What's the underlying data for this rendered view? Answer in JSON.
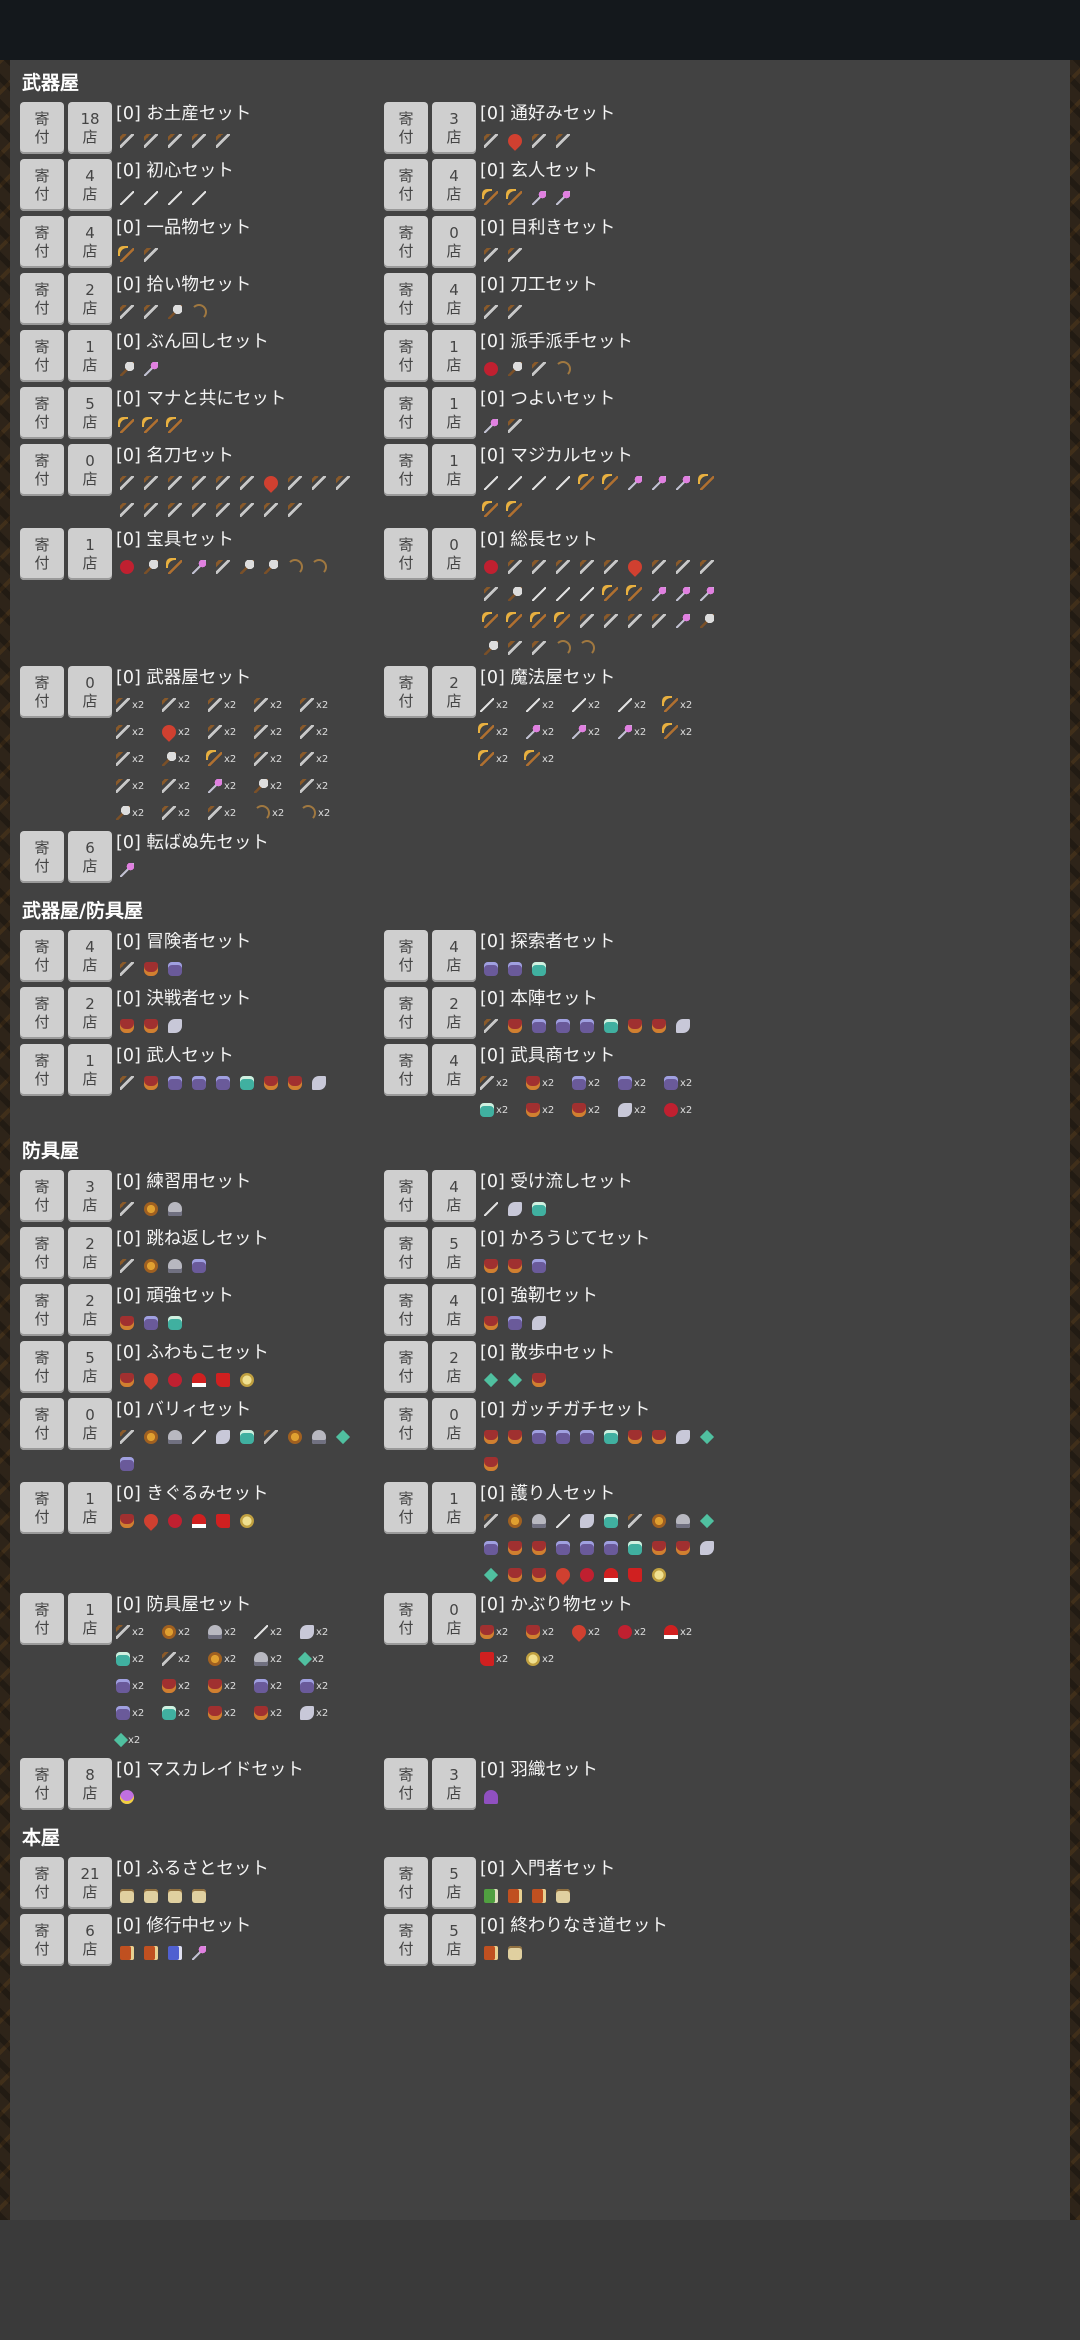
{
  "btn": {
    "donate": [
      "寄",
      "付"
    ],
    "shop_suffix": "店"
  },
  "sections": [
    {
      "title": "武器屋",
      "items": [
        {
          "shops": "18",
          "name": "[0] お土産セット",
          "icons": [
            "sword",
            "sword",
            "sword",
            "sword",
            "sword"
          ],
          "x2": false
        },
        {
          "shops": "3",
          "name": "[0] 通好みセット",
          "icons": [
            "sword",
            "fire",
            "sword",
            "sword"
          ],
          "x2": false
        },
        {
          "shops": "4",
          "name": "[0] 初心セット",
          "icons": [
            "spear",
            "spear",
            "spear",
            "spear"
          ],
          "x2": false
        },
        {
          "shops": "4",
          "name": "[0] 玄人セット",
          "icons": [
            "staff",
            "staff",
            "wand",
            "wand"
          ],
          "x2": false
        },
        {
          "shops": "4",
          "name": "[0] 一品物セット",
          "icons": [
            "staff",
            "sword"
          ],
          "x2": false
        },
        {
          "shops": "0",
          "name": "[0] 目利きセット",
          "icons": [
            "sword",
            "sword"
          ],
          "x2": false
        },
        {
          "shops": "2",
          "name": "[0] 拾い物セット",
          "icons": [
            "sword",
            "sword",
            "axe",
            "bow"
          ],
          "x2": false
        },
        {
          "shops": "4",
          "name": "[0] 刀工セット",
          "icons": [
            "sword",
            "sword"
          ],
          "x2": false
        },
        {
          "shops": "1",
          "name": "[0] ぶん回しセット",
          "icons": [
            "axe",
            "wand"
          ],
          "x2": false
        },
        {
          "shops": "1",
          "name": "[0] 派手派手セット",
          "icons": [
            "red",
            "axe",
            "sword",
            "bow"
          ],
          "x2": false
        },
        {
          "shops": "5",
          "name": "[0] マナと共にセット",
          "icons": [
            "staff",
            "staff",
            "staff"
          ],
          "x2": false
        },
        {
          "shops": "1",
          "name": "[0] つよいセット",
          "icons": [
            "wand",
            "sword"
          ],
          "x2": false
        },
        {
          "shops": "0",
          "name": "[0] 名刀セット",
          "icons": [
            "sword",
            "sword",
            "sword",
            "sword",
            "sword",
            "sword",
            "fire",
            "sword",
            "sword",
            "sword",
            "sword",
            "sword",
            "sword",
            "sword",
            "sword",
            "sword",
            "sword",
            "sword"
          ],
          "x2": false
        },
        {
          "shops": "1",
          "name": "[0] マジカルセット",
          "icons": [
            "spear",
            "spear",
            "spear",
            "spear",
            "staff",
            "staff",
            "wand",
            "wand",
            "wand",
            "staff",
            "staff",
            "staff"
          ],
          "x2": false
        },
        {
          "shops": "1",
          "name": "[0] 宝具セット",
          "icons": [
            "red",
            "axe",
            "staff",
            "wand",
            "sword",
            "axe",
            "axe",
            "bow",
            "bow"
          ],
          "x2": false
        },
        {
          "shops": "0",
          "name": "[0] 総長セット",
          "icons": [
            "red",
            "sword",
            "sword",
            "sword",
            "sword",
            "sword",
            "fire",
            "sword",
            "sword",
            "sword",
            "sword",
            "axe",
            "spear",
            "spear",
            "spear",
            "staff",
            "staff",
            "wand",
            "wand",
            "wand",
            "staff",
            "staff",
            "staff",
            "staff",
            "sword",
            "sword",
            "sword",
            "sword",
            "wand",
            "axe",
            "axe",
            "sword",
            "sword",
            "bow",
            "bow"
          ],
          "x2": false
        },
        {
          "shops": "0",
          "name": "[0] 武器屋セット",
          "icons": [
            "sword",
            "sword",
            "sword",
            "sword",
            "sword",
            "sword",
            "fire",
            "sword",
            "sword",
            "sword",
            "sword",
            "axe",
            "staff",
            "sword",
            "sword",
            "sword",
            "sword",
            "wand",
            "axe",
            "sword",
            "axe",
            "sword",
            "sword",
            "bow",
            "bow"
          ],
          "x2": true
        },
        {
          "shops": "2",
          "name": "[0] 魔法屋セット",
          "icons": [
            "spear",
            "spear",
            "spear",
            "spear",
            "staff",
            "staff",
            "wand",
            "wand",
            "wand",
            "staff",
            "staff",
            "staff"
          ],
          "x2": true
        },
        {
          "shops": "6",
          "name": "[0] 転ばぬ先セット",
          "icons": [
            "wand"
          ],
          "x2": false
        }
      ]
    },
    {
      "title": "武器屋/防具屋",
      "items": [
        {
          "shops": "4",
          "name": "[0] 冒険者セット",
          "icons": [
            "sword",
            "armor",
            "glove"
          ],
          "x2": false
        },
        {
          "shops": "4",
          "name": "[0] 探索者セット",
          "icons": [
            "glove",
            "glove",
            "teal"
          ],
          "x2": false
        },
        {
          "shops": "2",
          "name": "[0] 決戦者セット",
          "icons": [
            "armor",
            "armor",
            "wing"
          ],
          "x2": false
        },
        {
          "shops": "2",
          "name": "[0] 本陣セット",
          "icons": [
            "sword",
            "armor",
            "glove",
            "glove",
            "glove",
            "teal",
            "armor",
            "armor",
            "wing"
          ],
          "x2": false
        },
        {
          "shops": "1",
          "name": "[0] 武人セット",
          "icons": [
            "sword",
            "armor",
            "glove",
            "glove",
            "glove",
            "teal",
            "armor",
            "armor",
            "wing"
          ],
          "x2": false
        },
        {
          "shops": "4",
          "name": "[0] 武具商セット",
          "icons": [
            "sword",
            "armor",
            "glove",
            "glove",
            "glove",
            "teal",
            "armor",
            "armor",
            "wing",
            "red"
          ],
          "x2": true
        }
      ]
    },
    {
      "title": "防具屋",
      "items": [
        {
          "shops": "3",
          "name": "[0] 練習用セット",
          "icons": [
            "sword",
            "shield",
            "helm"
          ],
          "x2": false
        },
        {
          "shops": "4",
          "name": "[0] 受け流しセット",
          "icons": [
            "spear",
            "wing",
            "teal"
          ],
          "x2": false
        },
        {
          "shops": "2",
          "name": "[0] 跳ね返しセット",
          "icons": [
            "sword",
            "shield",
            "helm",
            "glove"
          ],
          "x2": false
        },
        {
          "shops": "5",
          "name": "[0] かろうじてセット",
          "icons": [
            "armor",
            "armor",
            "glove"
          ],
          "x2": false
        },
        {
          "shops": "2",
          "name": "[0] 頑強セット",
          "icons": [
            "armor",
            "glove",
            "teal"
          ],
          "x2": false
        },
        {
          "shops": "4",
          "name": "[0] 強靭セット",
          "icons": [
            "armor",
            "glove",
            "wing"
          ],
          "x2": false
        },
        {
          "shops": "5",
          "name": "[0] ふわもこセット",
          "icons": [
            "armor",
            "fire",
            "red",
            "hat",
            "boot",
            "gold"
          ],
          "x2": false
        },
        {
          "shops": "2",
          "name": "[0] 散歩中セット",
          "icons": [
            "gem",
            "gem",
            "armor"
          ],
          "x2": false
        },
        {
          "shops": "0",
          "name": "[0] バリィセット",
          "icons": [
            "sword",
            "shield",
            "helm",
            "spear",
            "wing",
            "teal",
            "sword",
            "shield",
            "helm",
            "gem",
            "glove"
          ],
          "x2": false
        },
        {
          "shops": "0",
          "name": "[0] ガッチガチセット",
          "icons": [
            "armor",
            "armor",
            "glove",
            "glove",
            "glove",
            "teal",
            "armor",
            "armor",
            "wing",
            "gem",
            "armor"
          ],
          "x2": false
        },
        {
          "shops": "1",
          "name": "[0] きぐるみセット",
          "icons": [
            "armor",
            "fire",
            "red",
            "hat",
            "boot",
            "gold"
          ],
          "x2": false
        },
        {
          "shops": "1",
          "name": "[0] 護り人セット",
          "icons": [
            "sword",
            "shield",
            "helm",
            "spear",
            "wing",
            "teal",
            "sword",
            "shield",
            "helm",
            "gem",
            "glove",
            "armor",
            "armor",
            "glove",
            "glove",
            "glove",
            "teal",
            "armor",
            "armor",
            "wing",
            "gem",
            "armor",
            "armor",
            "fire",
            "red",
            "hat",
            "boot",
            "gold"
          ],
          "x2": false
        },
        {
          "shops": "1",
          "name": "[0] 防具屋セット",
          "icons": [
            "sword",
            "shield",
            "helm",
            "spear",
            "wing",
            "teal",
            "sword",
            "shield",
            "helm",
            "gem",
            "glove",
            "armor",
            "armor",
            "glove",
            "glove",
            "glove",
            "teal",
            "armor",
            "armor",
            "wing",
            "gem"
          ],
          "x2": true
        },
        {
          "shops": "0",
          "name": "[0] かぶり物セット",
          "icons": [
            "armor",
            "armor",
            "fire",
            "red",
            "hat",
            "boot",
            "gold"
          ],
          "x2": true
        },
        {
          "shops": "8",
          "name": "[0] マスカレイドセット",
          "icons": [
            "mask"
          ],
          "x2": false
        },
        {
          "shops": "3",
          "name": "[0] 羽織セット",
          "icons": [
            "cloak"
          ],
          "x2": false
        }
      ]
    },
    {
      "title": "本屋",
      "items": [
        {
          "shops": "21",
          "name": "[0] ふるさとセット",
          "icons": [
            "scroll",
            "scroll",
            "scroll",
            "scroll"
          ],
          "x2": false
        },
        {
          "shops": "5",
          "name": "[0] 入門者セット",
          "icons": [
            "bookg",
            "book",
            "book",
            "scroll"
          ],
          "x2": false
        },
        {
          "shops": "6",
          "name": "[0] 修行中セット",
          "icons": [
            "book",
            "book",
            "bookb",
            "wand"
          ],
          "x2": false
        },
        {
          "shops": "5",
          "name": "[0] 終わりなき道セット",
          "icons": [
            "book",
            "scroll"
          ],
          "x2": false
        }
      ]
    }
  ]
}
